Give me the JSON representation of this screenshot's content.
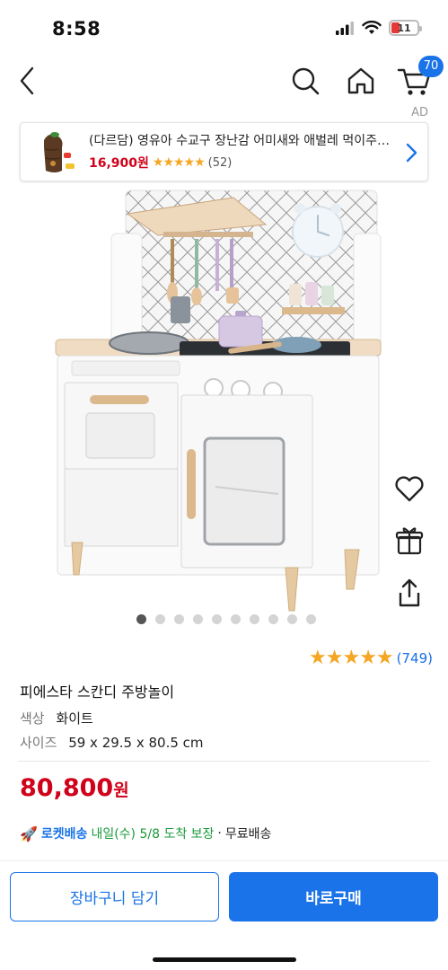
{
  "status_bar": {
    "time": "8:58",
    "battery_level": "11"
  },
  "nav": {
    "cart_count": "70",
    "ad_label": "AD"
  },
  "ad": {
    "title": "(다르담) 영유아 수교구 장난감 어미새와 애벌레 먹이주기 놀이",
    "price": "16,900원",
    "stars": "★★★★★",
    "review_count": "(52)"
  },
  "gallery": {
    "dot_count": 10,
    "active_index": 0
  },
  "side_actions": [
    "heart-icon",
    "gift-icon",
    "share-icon"
  ],
  "product": {
    "rating_stars": "★★★★★",
    "rating_value": 4.5,
    "review_count": "(749)",
    "title": "피에스타 스칸디 주방놀이",
    "color_label": "색상",
    "color_value": "화이트",
    "size_label": "사이즈",
    "size_value": "59 x 29.5 x 80.5 cm",
    "price": "80,800",
    "price_unit": "원"
  },
  "delivery": {
    "rocket_label": "로켓배송",
    "date_text": "내일(수) 5/8 도착 보장",
    "separator": "·",
    "free_text": "무료배송"
  },
  "buttons": {
    "add_to_cart": "장바구니 담기",
    "buy_now": "바로구매"
  },
  "colors": {
    "accent": "#1a73e8",
    "price": "#d0021b",
    "star": "#f5a623",
    "delivery_green": "#1a9a3c"
  }
}
